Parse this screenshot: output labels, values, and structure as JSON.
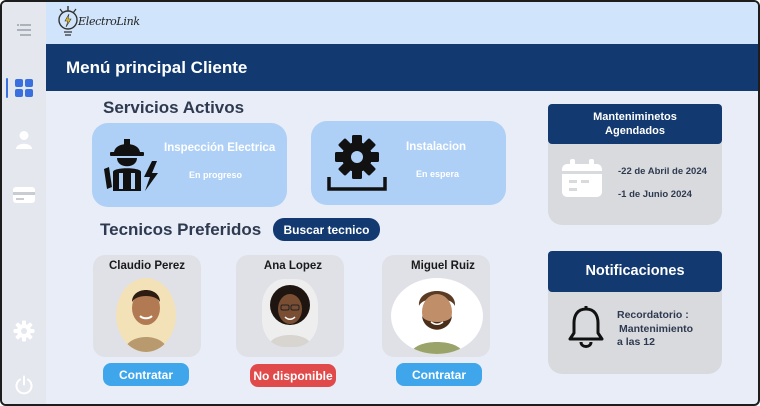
{
  "app": {
    "name": "ElectroLink"
  },
  "sidebar": {
    "items": [
      {
        "name": "menu-icon"
      },
      {
        "name": "dashboard-icon"
      },
      {
        "name": "user-icon"
      },
      {
        "name": "card-icon"
      },
      {
        "name": "settings-icon"
      },
      {
        "name": "power-icon"
      }
    ]
  },
  "header": {
    "title": "Menú principal Cliente"
  },
  "services": {
    "title": "Servicios Activos",
    "items": [
      {
        "name": "Inspección  Electrica",
        "status": "En progreso",
        "icon": "electrician-icon"
      },
      {
        "name": "Instalacion",
        "status": "En espera",
        "icon": "installation-gear-icon"
      }
    ]
  },
  "technicians": {
    "title": "Tecnicos Preferidos",
    "search_label": "Buscar tecnico",
    "items": [
      {
        "name": "Claudio Perez",
        "action": "Contratar",
        "available": true
      },
      {
        "name": "Ana Lopez",
        "action": "No disponible",
        "available": false
      },
      {
        "name": "Miguel Ruiz",
        "action": "Contratar",
        "available": true
      }
    ]
  },
  "maintenance": {
    "title_line1": "Manteniminetos",
    "title_line2": "Agendados",
    "dates": [
      "-22 de Abril de 2024",
      "-1 de Junio 2024"
    ]
  },
  "notifications": {
    "title": "Notificaciones",
    "line1": "Recordatorio :",
    "line2": "Mantenimiento",
    "line3": "a las 12"
  },
  "colors": {
    "primary": "#123a70",
    "card_blue": "#aed0f6",
    "accent": "#3fa6ec",
    "danger": "#e04a4a",
    "background": "#e9edf7"
  }
}
